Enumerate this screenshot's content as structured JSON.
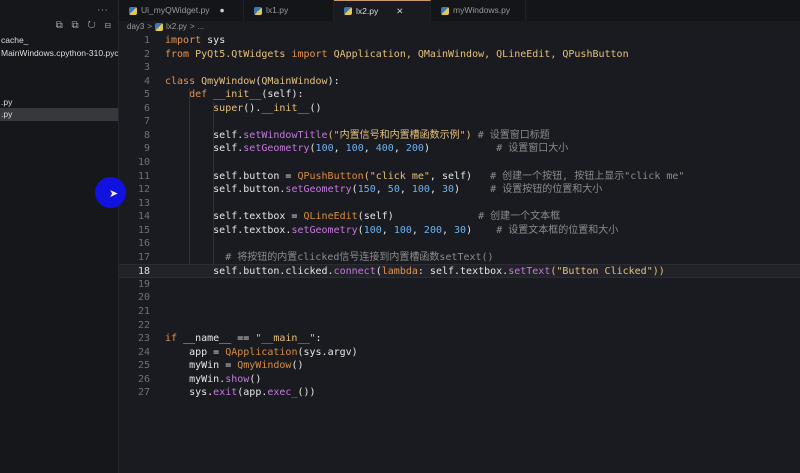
{
  "sidebar": {
    "more": "···",
    "tools": "⧉ ⧉ ↻ ⊟",
    "items": [
      {
        "label": "cache_",
        "selected": false
      },
      {
        "label": "MainWindows.cpython-310.pyc",
        "selected": false
      },
      {
        "label": "",
        "selected": false
      },
      {
        "label": "",
        "selected": false
      },
      {
        "label": ".py",
        "selected": false
      },
      {
        "label": ".py",
        "selected": true
      }
    ]
  },
  "tabs": [
    {
      "label": "Ui_myQWidget.py",
      "modified": true,
      "active": false
    },
    {
      "label": "lx1.py",
      "active": false
    },
    {
      "label": "lx2.py",
      "active": true,
      "close": "✕"
    },
    {
      "label": "myWindows.py",
      "active": false
    }
  ],
  "breadcrumb": [
    "day3",
    ">",
    "lx2.py",
    ">",
    "..."
  ],
  "editor": {
    "current_line": 18,
    "lines": [
      [
        [
          "import ",
          "k"
        ],
        [
          "sys",
          "t"
        ]
      ],
      [
        [
          "from ",
          "k"
        ],
        [
          "PyQt5.QtWidgets ",
          "s"
        ],
        [
          "import ",
          "k"
        ],
        [
          "QApplication, QMainWindow, QLineEdit, QPushButton",
          "s"
        ]
      ],
      [],
      [
        [
          "class ",
          "k"
        ],
        [
          "QmyWindow",
          "s"
        ],
        [
          "(",
          "t"
        ],
        [
          "QMainWindow",
          "s"
        ],
        [
          "):",
          "t"
        ]
      ],
      [
        [
          "    def ",
          "k"
        ],
        [
          "__init__",
          "s"
        ],
        [
          "(self):",
          "t"
        ]
      ],
      [
        [
          "        super",
          "s"
        ],
        [
          "().",
          "t"
        ],
        [
          "__init__",
          "s"
        ],
        [
          "()",
          "t"
        ]
      ],
      [],
      [
        [
          "        self.",
          "t"
        ],
        [
          "setWindowTitle",
          "m"
        ],
        [
          "(\"内置信号和内置槽函数示例\") ",
          "s"
        ],
        [
          "# 设置窗口标题",
          "c"
        ]
      ],
      [
        [
          "        self.",
          "t"
        ],
        [
          "setGeometry",
          "m"
        ],
        [
          "(",
          "t"
        ],
        [
          "100",
          "n"
        ],
        [
          ", ",
          "t"
        ],
        [
          "100",
          "n"
        ],
        [
          ", ",
          "t"
        ],
        [
          "400",
          "n"
        ],
        [
          ", ",
          "t"
        ],
        [
          "200",
          "n"
        ],
        [
          ")           ",
          "t"
        ],
        [
          "# 设置窗口大小",
          "c"
        ]
      ],
      [],
      [
        [
          "        self.button = ",
          "t"
        ],
        [
          "QPushButton",
          "f"
        ],
        [
          "(\"click me\"",
          "s"
        ],
        [
          ", self)   ",
          "t"
        ],
        [
          "# 创建一个按钮, 按钮上显示\"click me\"",
          "c"
        ]
      ],
      [
        [
          "        self.button.",
          "t"
        ],
        [
          "setGeometry",
          "m"
        ],
        [
          "(",
          "t"
        ],
        [
          "150",
          "n"
        ],
        [
          ", ",
          "t"
        ],
        [
          "50",
          "n"
        ],
        [
          ", ",
          "t"
        ],
        [
          "100",
          "n"
        ],
        [
          ", ",
          "t"
        ],
        [
          "30",
          "n"
        ],
        [
          ")     ",
          "t"
        ],
        [
          "# 设置按钮的位置和大小",
          "c"
        ]
      ],
      [],
      [
        [
          "        self.textbox = ",
          "t"
        ],
        [
          "QLineEdit",
          "f"
        ],
        [
          "(self)              ",
          "t"
        ],
        [
          "# 创建一个文本框",
          "c"
        ]
      ],
      [
        [
          "        self.textbox.",
          "t"
        ],
        [
          "setGeometry",
          "m"
        ],
        [
          "(",
          "t"
        ],
        [
          "100",
          "n"
        ],
        [
          ", ",
          "t"
        ],
        [
          "100",
          "n"
        ],
        [
          ", ",
          "t"
        ],
        [
          "200",
          "n"
        ],
        [
          ", ",
          "t"
        ],
        [
          "30",
          "n"
        ],
        [
          ")    ",
          "t"
        ],
        [
          "# 设置文本框的位置和大小",
          "c"
        ]
      ],
      [],
      [
        [
          "          # 将按钮的内置clicked信号连接到内置槽函数setText()",
          "c"
        ]
      ],
      [
        [
          "        self.button.clicked.",
          "t"
        ],
        [
          "connect",
          "m"
        ],
        [
          "(",
          "t"
        ],
        [
          "lambda",
          "k"
        ],
        [
          ": self.textbox.",
          "t"
        ],
        [
          "setText",
          "m"
        ],
        [
          "(\"Button Clicked\"))",
          "s"
        ]
      ],
      [],
      [],
      [],
      [],
      [
        [
          "if ",
          "k"
        ],
        [
          "__name__ == ",
          "t"
        ],
        [
          "\"__main__\"",
          "s"
        ],
        [
          ":",
          "t"
        ]
      ],
      [
        [
          "    app = ",
          "t"
        ],
        [
          "QApplication",
          "f"
        ],
        [
          "(sys.argv)",
          "t"
        ]
      ],
      [
        [
          "    myWin = ",
          "t"
        ],
        [
          "QmyWindow",
          "f"
        ],
        [
          "()",
          "t"
        ]
      ],
      [
        [
          "    myWin.",
          "t"
        ],
        [
          "show",
          "m"
        ],
        [
          "()",
          "t"
        ]
      ],
      [
        [
          "    sys.",
          "t"
        ],
        [
          "exit",
          "m"
        ],
        [
          "(app.",
          "t"
        ],
        [
          "exec_",
          "m"
        ],
        [
          "())",
          "t"
        ]
      ]
    ]
  },
  "pointer_highlight_color": "#1212e0"
}
